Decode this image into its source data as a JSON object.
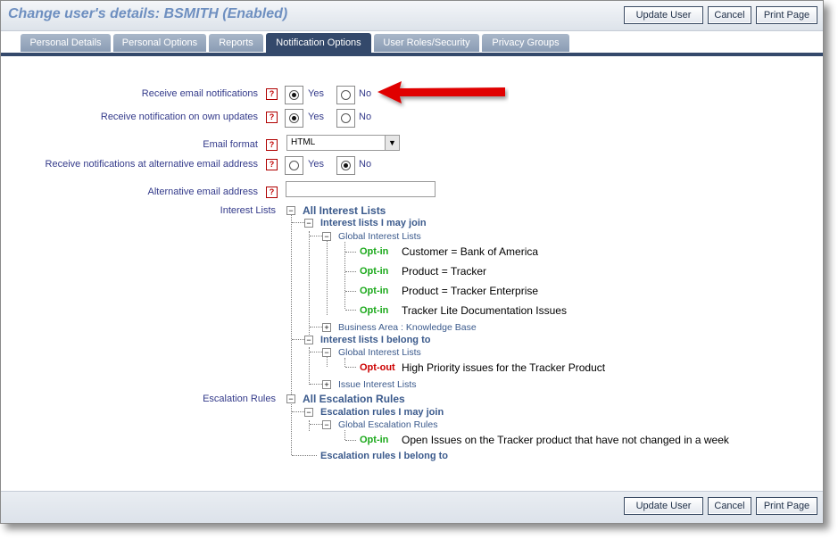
{
  "header": {
    "title": "Change user's details: BSMITH (Enabled)"
  },
  "buttons": {
    "update": "Update User",
    "cancel": "Cancel",
    "print": "Print Page"
  },
  "tabs": [
    {
      "label": "Personal Details",
      "active": false
    },
    {
      "label": "Personal Options",
      "active": false
    },
    {
      "label": "Reports",
      "active": false
    },
    {
      "label": "Notification Options",
      "active": true
    },
    {
      "label": "User Roles/Security",
      "active": false
    },
    {
      "label": "Privacy Groups",
      "active": false
    }
  ],
  "help_glyph": "?",
  "form": {
    "email_notifications": {
      "label": "Receive email notifications",
      "yes": "Yes",
      "no": "No",
      "value": "Yes"
    },
    "own_updates": {
      "label": "Receive notification on own updates",
      "yes": "Yes",
      "no": "No",
      "value": "Yes"
    },
    "email_format": {
      "label": "Email format",
      "value": "HTML"
    },
    "alt_email_notifications": {
      "label": "Receive notifications at alternative email address",
      "yes": "Yes",
      "no": "No",
      "value": "No"
    },
    "alt_email": {
      "label": "Alternative email address",
      "value": ""
    }
  },
  "interest_lists": {
    "label": "Interest Lists",
    "root": "All Interest Lists",
    "may_join": "Interest lists I may join",
    "global": "Global Interest Lists",
    "items_join": [
      {
        "status": "Opt-in",
        "name": "Customer = Bank of America"
      },
      {
        "status": "Opt-in",
        "name": "Product = Tracker"
      },
      {
        "status": "Opt-in",
        "name": "Product = Tracker Enterprise"
      },
      {
        "status": "Opt-in",
        "name": "Tracker Lite Documentation Issues"
      }
    ],
    "business_area": "Business Area : Knowledge Base",
    "belong_to": "Interest lists I belong to",
    "global2": "Global Interest Lists",
    "items_belong": [
      {
        "status": "Opt-out",
        "name": "High Priority issues for the Tracker Product"
      }
    ],
    "issue_lists": "Issue Interest Lists"
  },
  "escalation": {
    "label": "Escalation Rules",
    "root": "All Escalation Rules",
    "may_join": "Escalation rules I may join",
    "global": "Global Escalation Rules",
    "items": [
      {
        "status": "Opt-in",
        "name": "Open Issues on the Tracker product that have not changed in a week"
      }
    ],
    "belong_to": "Escalation rules I belong to"
  },
  "colors": {
    "tab_active": "#34496b",
    "optin": "#1aa81a",
    "optout": "#cc0000",
    "arrow": "#e00000",
    "title": "#6e8fc0"
  }
}
